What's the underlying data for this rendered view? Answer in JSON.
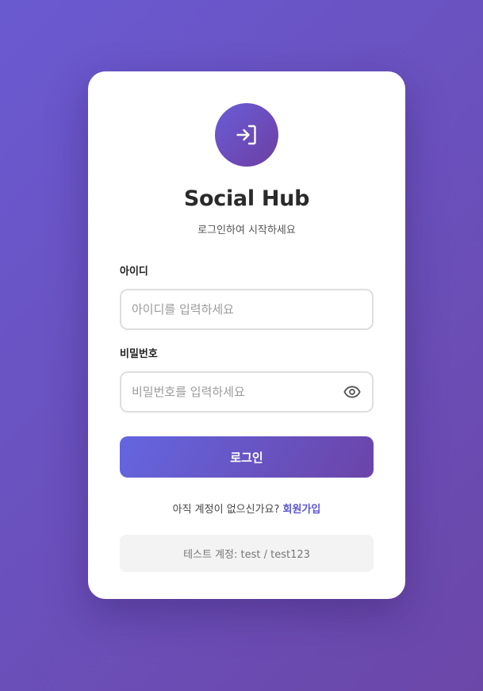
{
  "app": {
    "title": "Social Hub",
    "subtitle": "로그인하여 시작하세요",
    "logo_icon": "login-arrow-icon"
  },
  "form": {
    "username": {
      "label": "아이디",
      "placeholder": "아이디를 입력하세요",
      "value": ""
    },
    "password": {
      "label": "비밀번호",
      "placeholder": "비밀번호를 입력하세요",
      "value": "",
      "toggle_icon": "eye-icon"
    },
    "submit_label": "로그인"
  },
  "signup": {
    "prompt": "아직 계정이 없으신가요?",
    "link_label": "회원가입"
  },
  "test_account": {
    "text": "테스트 계정: test / test123"
  },
  "colors": {
    "background_start": "#6a5ad1",
    "background_end": "#6b47a8",
    "accent": "#5b55d6",
    "card": "#ffffff"
  }
}
